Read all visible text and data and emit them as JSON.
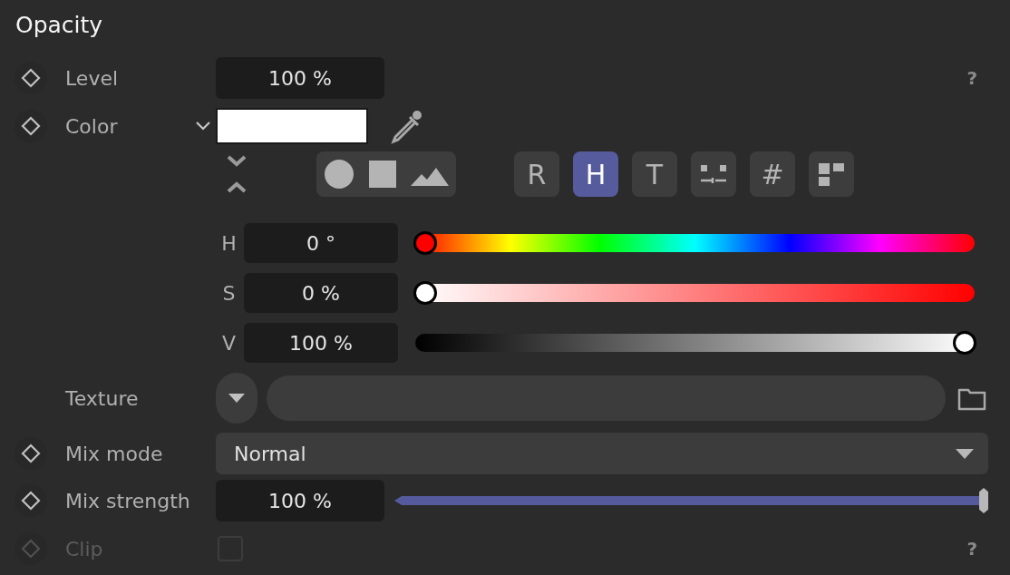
{
  "title": "Opacity",
  "level_row": {
    "label": "Level",
    "keyframe": true,
    "value": "100 %",
    "help": "?"
  },
  "color_row": {
    "label": "Color",
    "keyframe": true,
    "expanded": true
  },
  "shape_modes": [
    {
      "kind": "circle"
    },
    {
      "kind": "square"
    },
    {
      "kind": "mountains"
    }
  ],
  "picker_modes": [
    {
      "kind": "text",
      "label": "R",
      "selected": false
    },
    {
      "kind": "text",
      "label": "H",
      "selected": true
    },
    {
      "kind": "text",
      "label": "T",
      "selected": false
    },
    {
      "kind": "mixer",
      "selected": false
    },
    {
      "kind": "text",
      "label": "#",
      "selected": false
    },
    {
      "kind": "swatches",
      "selected": false
    }
  ],
  "channels": [
    {
      "kind": "hue",
      "label": "H",
      "value": "0 °",
      "level": 0
    },
    {
      "kind": "saturation",
      "label": "S",
      "value": "0 %",
      "level": 0
    },
    {
      "kind": "brightness",
      "label": "V",
      "value": "100 %",
      "level": 1
    }
  ],
  "texture_row": {
    "label": "Texture",
    "keyframe": false
  },
  "mix_mode_row": {
    "label": "Mix mode",
    "keyframe": true,
    "value": "Normal"
  },
  "mix_strength_row": {
    "label": "Mix strength",
    "keyframe": true,
    "value": "100 %",
    "level": 1
  },
  "clip_row": {
    "label": "Clip",
    "keyframe": true,
    "disabled": true,
    "checked": false,
    "help": "?"
  }
}
